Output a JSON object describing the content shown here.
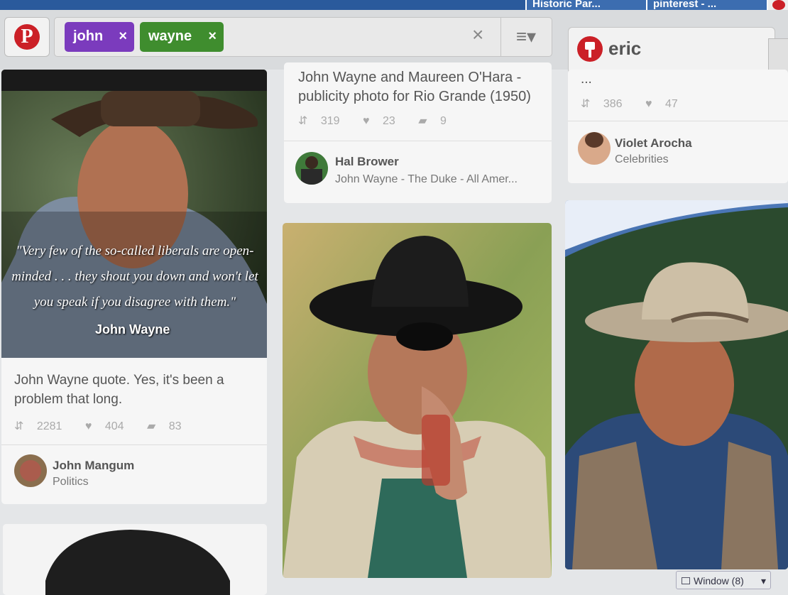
{
  "browser": {
    "tabs": [
      {
        "label": "Historic Par..."
      },
      {
        "label": "pinterest - ..."
      }
    ]
  },
  "header": {
    "search": {
      "tokens": [
        {
          "label": "john",
          "color": "#7b3bbd"
        },
        {
          "label": "wayne",
          "color": "#3f8d2e"
        }
      ],
      "clear_symbol": "×",
      "token_remove_symbol": "×",
      "menu_symbol": "≡▾"
    },
    "secondary_search": {
      "value": "eric"
    },
    "brand_color": "#cb2027"
  },
  "pins": {
    "col1": {
      "quote": "\"Very few of the so-called liberals are open-minded . . . they shout you down and won't let you speak if you disagree with them.\"",
      "quote_author": "John Wayne",
      "description": "John Wayne quote. Yes, it's been a problem that long.",
      "repins": "2281",
      "likes": "404",
      "comments": "83",
      "pinner": "John Mangum",
      "board": "Politics"
    },
    "col2_top": {
      "description": "John Wayne and Maureen O'Hara - publicity photo for Rio Grande (1950)",
      "repins": "319",
      "likes": "23",
      "comments": "9",
      "pinner": "Hal Brower",
      "board": "John Wayne - The Duke - All Amer..."
    },
    "col3_top": {
      "description": "...",
      "repins": "386",
      "likes": "47",
      "pinner": "Violet Arocha",
      "board": "Celebrities"
    }
  },
  "statusbar": {
    "window_label": "Window (8)"
  }
}
